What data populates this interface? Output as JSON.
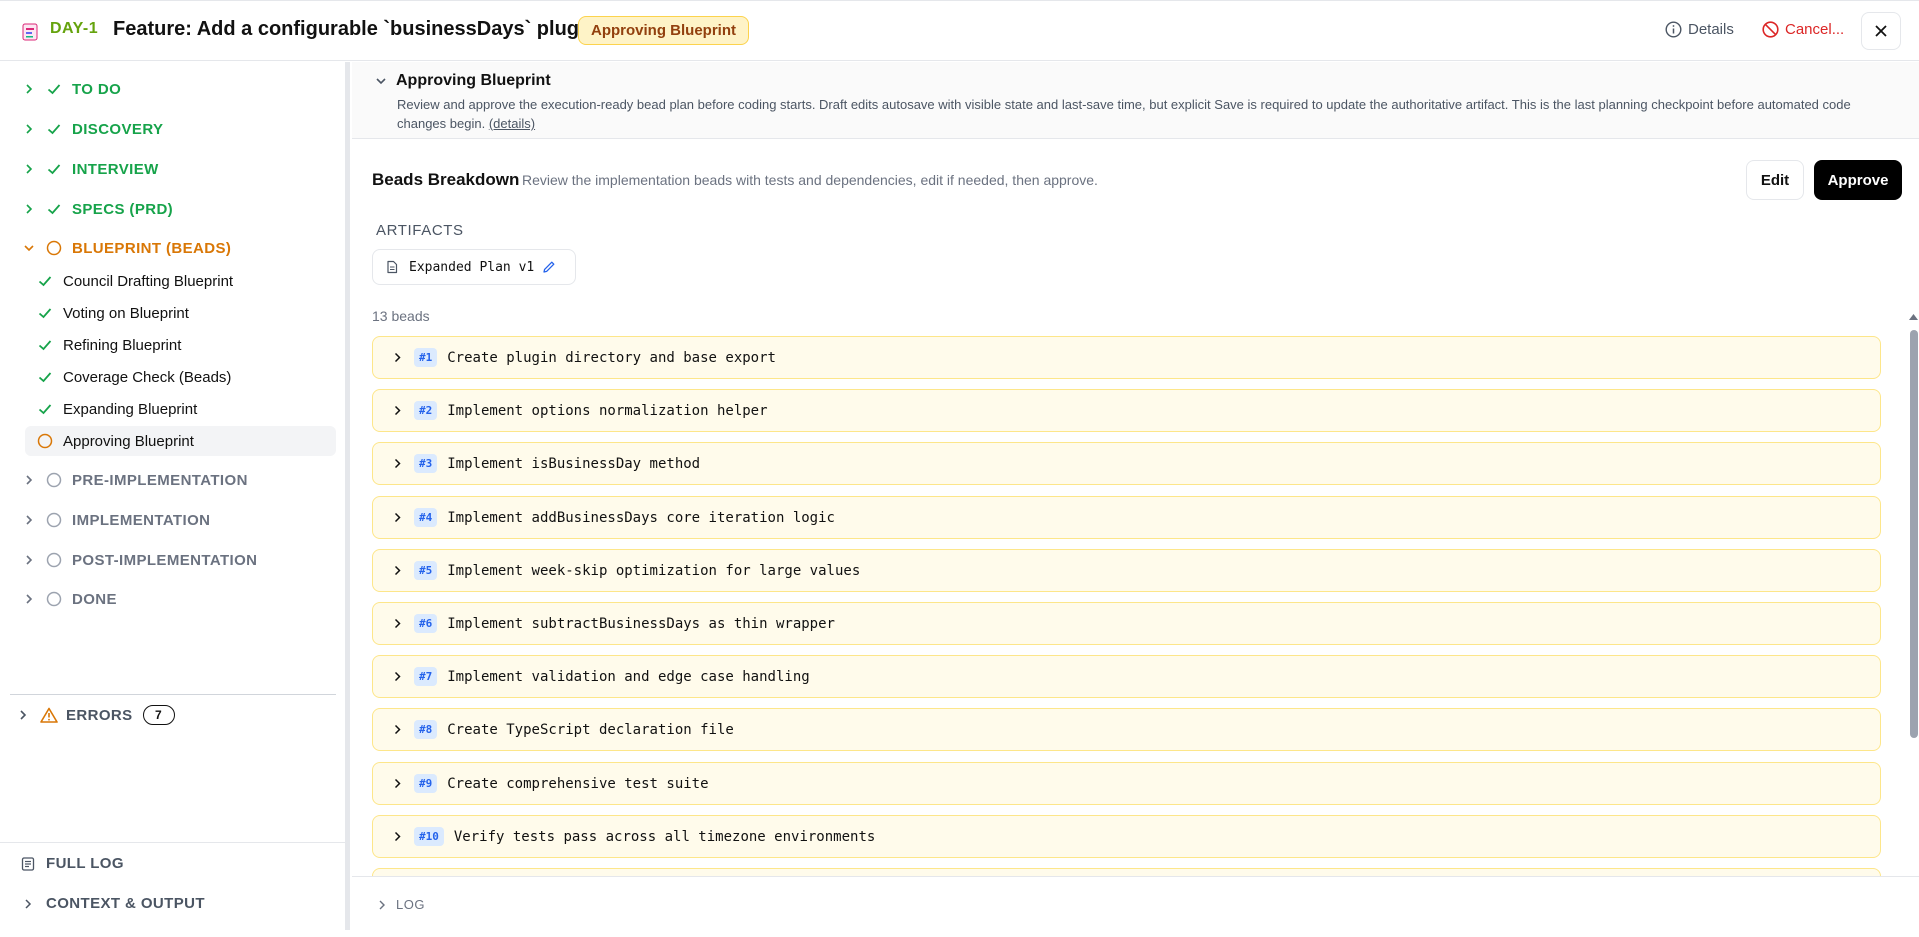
{
  "header": {
    "ticket_id": "DAY-1",
    "title": "Feature: Add a configurable `businessDays` plugin",
    "status": "Approving Blueprint",
    "details_label": "Details",
    "cancel_label": "Cancel..."
  },
  "sidebar": {
    "phases_top": [
      {
        "label": "TO DO",
        "state": "done"
      },
      {
        "label": "DISCOVERY",
        "state": "done"
      },
      {
        "label": "INTERVIEW",
        "state": "done"
      },
      {
        "label": "SPECS (PRD)",
        "state": "done"
      },
      {
        "label": "BLUEPRINT (BEADS)",
        "state": "active"
      }
    ],
    "substeps": [
      {
        "label": "Council Drafting Blueprint",
        "state": "done"
      },
      {
        "label": "Voting on Blueprint",
        "state": "done"
      },
      {
        "label": "Refining Blueprint",
        "state": "done"
      },
      {
        "label": "Coverage Check (Beads)",
        "state": "done"
      },
      {
        "label": "Expanding Blueprint",
        "state": "done"
      },
      {
        "label": "Approving Blueprint",
        "state": "current"
      }
    ],
    "phases_bottom": [
      {
        "label": "PRE-IMPLEMENTATION",
        "state": "pending"
      },
      {
        "label": "IMPLEMENTATION",
        "state": "pending"
      },
      {
        "label": "POST-IMPLEMENTATION",
        "state": "pending"
      },
      {
        "label": "DONE",
        "state": "pending"
      }
    ],
    "errors_label": "ERRORS",
    "errors_count": "7",
    "full_log_label": "FULL LOG",
    "context_label": "CONTEXT & OUTPUT"
  },
  "blueprint": {
    "title": "Approving Blueprint",
    "description": "Review and approve the execution-ready bead plan before coding starts. Draft edits autosave with visible state and last-save time, but explicit Save is required to update the authoritative artifact. This is the last planning checkpoint before automated code changes begin.",
    "details_link": "(details)"
  },
  "beads_breakdown": {
    "title": "Beads Breakdown",
    "subtitle": "Review the implementation beads with tests and dependencies, edit if needed, then approve.",
    "edit_label": "Edit",
    "approve_label": "Approve",
    "artifacts_label": "ARTIFACTS",
    "artifact_name": "Expanded Plan v1",
    "count_label": "13 beads",
    "beads": [
      {
        "num": "#1",
        "title": "Create plugin directory and base export"
      },
      {
        "num": "#2",
        "title": "Implement options normalization helper"
      },
      {
        "num": "#3",
        "title": "Implement isBusinessDay method"
      },
      {
        "num": "#4",
        "title": "Implement addBusinessDays core iteration logic"
      },
      {
        "num": "#5",
        "title": "Implement week-skip optimization for large values"
      },
      {
        "num": "#6",
        "title": "Implement subtractBusinessDays as thin wrapper"
      },
      {
        "num": "#7",
        "title": "Implement validation and edge case handling"
      },
      {
        "num": "#8",
        "title": "Create TypeScript declaration file"
      },
      {
        "num": "#9",
        "title": "Create comprehensive test suite"
      },
      {
        "num": "#10",
        "title": "Verify tests pass across all timezone environments"
      }
    ]
  },
  "log": {
    "label": "LOG"
  },
  "colors": {
    "done": "#16a34a",
    "active": "#d97706",
    "pending": "#9ca3af",
    "bead_bg": "#fffbeb",
    "bead_border": "#fde68a",
    "danger": "#dc2626"
  },
  "icons": {
    "app": "ticket-icon",
    "details": "info-icon",
    "cancel": "ban-icon",
    "close": "x-icon",
    "done": "check-icon",
    "active": "circle-icon",
    "pending": "circle-icon",
    "errors": "warning-icon",
    "full_log": "scroll-icon",
    "artifact": "document-icon",
    "edit": "pencil-icon"
  }
}
